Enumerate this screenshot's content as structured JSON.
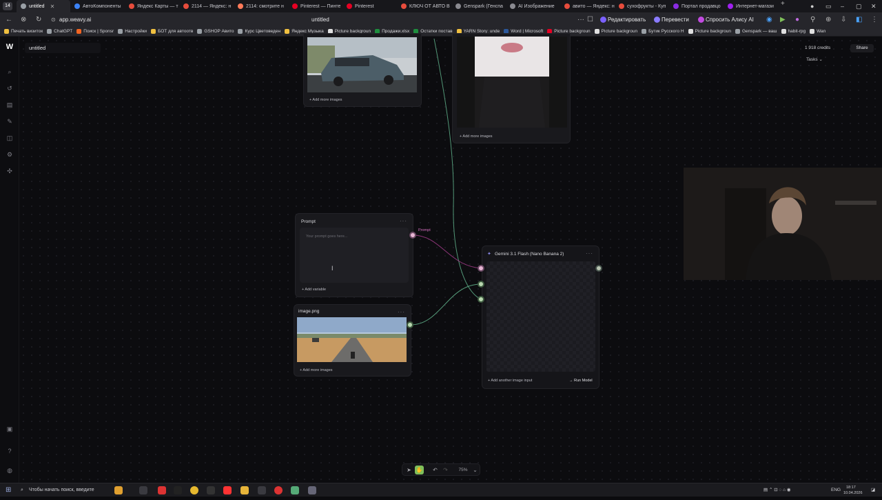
{
  "browser": {
    "tab_count": "14",
    "tabs": [
      {
        "label": "untitled",
        "active": true,
        "color": "#9aa0a6"
      },
      {
        "label": "АвтоКомпоненты",
        "color": "#3b82f6"
      },
      {
        "label": "Яндекс Карты — т",
        "color": "#e74c3c"
      },
      {
        "label": "2114 — Яндекс: н",
        "color": "#e74c3c"
      },
      {
        "label": "2114: смотрите н",
        "color": "#ff7a59"
      },
      {
        "label": "Pinterest — Пинте",
        "color": "#e60023"
      },
      {
        "label": "Pinterest",
        "color": "#e60023"
      },
      {
        "label": "КЛЮЧ ОТ АВТО В",
        "color": "#e74c3c"
      },
      {
        "label": "Genspark (Генспа",
        "color": "#8a8a90"
      },
      {
        "label": "AI Изображение",
        "color": "#8a8a90"
      },
      {
        "label": "авито — Яндекс: н",
        "color": "#e74c3c"
      },
      {
        "label": "сухофрукты - Куп",
        "color": "#e74c3c"
      },
      {
        "label": "Портал продавцо",
        "color": "#8a2be2"
      },
      {
        "label": "Интернет-магази",
        "color": "#a020f0"
      }
    ],
    "url": "app.weavy.ai",
    "page_title": "untitled",
    "actions": {
      "edit": "Редактировать",
      "translate": "Перевести",
      "ask_alice": "Спросить Алису AI"
    },
    "bookmarks": [
      {
        "label": "Печать визиток",
        "color": "#f0c040"
      },
      {
        "label": "ChatGPT",
        "color": "#9aa0a6"
      },
      {
        "label": "Поиск | Sponsr",
        "color": "#f26522"
      },
      {
        "label": "Настройки",
        "color": "#9aa0a6"
      },
      {
        "label": "БОТ для автоотв",
        "color": "#f0c040"
      },
      {
        "label": "GSHOP Авито",
        "color": "#9aa0a6"
      },
      {
        "label": "Курс Цветоведен",
        "color": "#9aa0a6"
      },
      {
        "label": "Яндекс Музыка",
        "color": "#f0c040"
      },
      {
        "label": "Picture backgroun",
        "color": "#e0e0e0"
      },
      {
        "label": "Продажи.xlsx",
        "color": "#1e8e3e"
      },
      {
        "label": "Остатки постав",
        "color": "#1e8e3e"
      },
      {
        "label": "YARN Story: unde",
        "color": "#f0c040"
      },
      {
        "label": "Word | Microsoft",
        "color": "#2b579a"
      },
      {
        "label": "Picture backgroun",
        "color": "#e60023"
      },
      {
        "label": "Picture backgroun",
        "color": "#e0e0e0"
      },
      {
        "label": "Бутик Русского Н",
        "color": "#9aa0a6"
      },
      {
        "label": "Picture backgroun",
        "color": "#e0e0e0"
      },
      {
        "label": "Genspark — ваш",
        "color": "#9aa0a6"
      },
      {
        "label": "habit-rpg",
        "color": "#e0e0e0"
      },
      {
        "label": "Wan",
        "color": "#e0e0e0"
      }
    ]
  },
  "app": {
    "project_title": "untitled",
    "credits": "1 918 credits",
    "share": "Share",
    "tasks": "Tasks",
    "rail_icons": [
      "search-icon",
      "history-icon",
      "library-icon",
      "edit-icon",
      "tools-icon",
      "settings-icon",
      "models-icon"
    ],
    "nodes": {
      "car": {
        "add_more": "+ Add more images"
      },
      "portrait": {
        "add_more": "+ Add more images"
      },
      "prompt": {
        "title": "Prompt",
        "menu": "···",
        "placeholder": "Your prompt goes here...",
        "add_variable": "+ Add variable",
        "port_label": "Prompt"
      },
      "image": {
        "title": "image.png",
        "menu": "···",
        "add_more": "+ Add more images"
      },
      "gemini": {
        "title": "Gemini 3.1 Flash (Nano Banana 2)",
        "menu": "···",
        "add_input": "+ Add another image input",
        "run": "→ Run Model"
      }
    },
    "toolbar": {
      "zoom": "75%"
    },
    "colors": {
      "prompt_edge": "#9b3a84",
      "image_edge": "#5fb08a",
      "accent_green": "#7fbf5a"
    }
  },
  "taskbar": {
    "search_placeholder": "Чтобы начать поиск, введите",
    "lang": "ENG",
    "time": "18:17",
    "date": "10.04.2026"
  }
}
